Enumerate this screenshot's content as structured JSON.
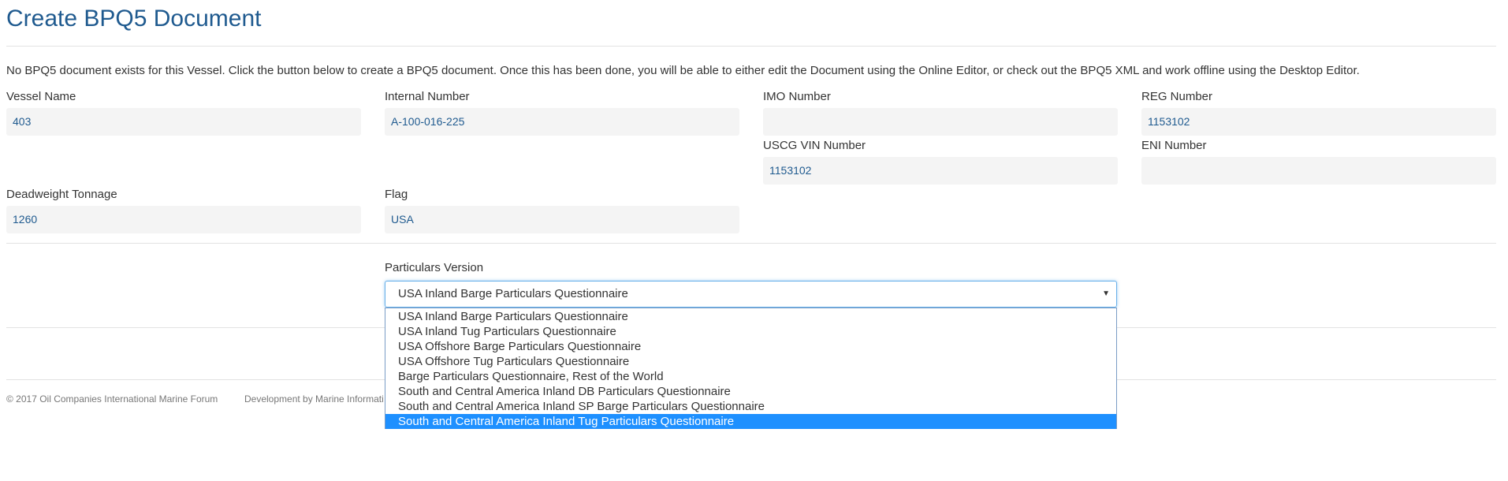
{
  "page": {
    "title": "Create BPQ5 Document",
    "intro": "No BPQ5 document exists for this Vessel. Click the button below to create a BPQ5 document. Once this has been done, you will be able to either edit the Document using the Online Editor, or check out the BPQ5 XML and work offline using the Desktop Editor."
  },
  "fields": {
    "vessel_name": {
      "label": "Vessel Name",
      "value": "403"
    },
    "internal_number": {
      "label": "Internal Number",
      "value": "A-100-016-225"
    },
    "imo_number": {
      "label": "IMO Number",
      "value": ""
    },
    "reg_number": {
      "label": "REG Number",
      "value": "1153102"
    },
    "uscg_vin_number": {
      "label": "USCG VIN Number",
      "value": "1153102"
    },
    "eni_number": {
      "label": "ENI Number",
      "value": ""
    },
    "deadweight_tonnage": {
      "label": "Deadweight Tonnage",
      "value": "1260"
    },
    "flag": {
      "label": "Flag",
      "value": "USA"
    }
  },
  "particulars": {
    "label": "Particulars Version",
    "selected": "USA Inland Barge Particulars Questionnaire",
    "options": [
      "USA Inland Barge Particulars Questionnaire",
      "USA Inland Tug Particulars Questionnaire",
      "USA Offshore Barge Particulars Questionnaire",
      "USA Offshore Tug Particulars Questionnaire",
      "Barge Particulars Questionnaire, Rest of the World",
      "South and Central America Inland DB Particulars Questionnaire",
      "South and Central America Inland SP Barge Particulars Questionnaire",
      "South and Central America Inland Tug Particulars Questionnaire"
    ],
    "highlighted_index": 7
  },
  "footer": {
    "copyright": "© 2017 Oil Companies International Marine Forum",
    "development": "Development by Marine Informati"
  },
  "colors": {
    "title": "#1f5a8f",
    "value_text": "#1f5a8f",
    "field_bg": "#f4f4f4",
    "focus_border": "#66afe9",
    "highlight": "#1e90ff"
  },
  "icons": {
    "select_arrow": "triangle-down-icon"
  }
}
